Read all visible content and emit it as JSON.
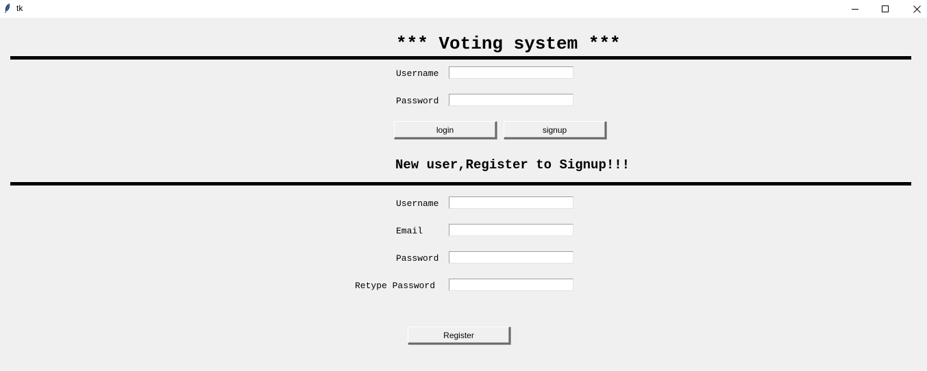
{
  "window": {
    "title": "tk",
    "icon": "tk-feather-icon",
    "controls": [
      "minimize-icon",
      "maximize-icon",
      "close-icon"
    ]
  },
  "login": {
    "heading": "*** Voting system ***",
    "username_label": "Username",
    "username_value": "",
    "password_label": "Password",
    "password_value": "",
    "login_button": "login",
    "signup_button": "signup"
  },
  "register": {
    "heading": "New user,Register to Signup!!!",
    "username_label": "Username",
    "username_value": "",
    "email_label": "Email",
    "email_value": "",
    "password_label": "Password",
    "password_value": "",
    "retype_label": "Retype Password",
    "retype_value": "",
    "register_button": "Register"
  }
}
